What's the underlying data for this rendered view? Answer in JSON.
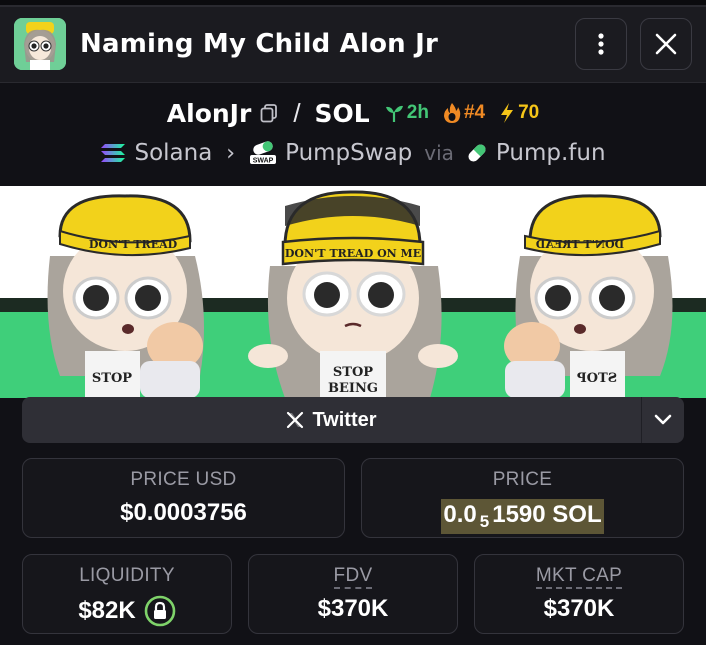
{
  "window": {
    "title": "Naming My Child Alon Jr"
  },
  "pair": {
    "base": "AlonJr",
    "separator": "/",
    "quote": "SOL",
    "age": "2h",
    "rank": "#4",
    "boost": "70"
  },
  "chain": {
    "network": "Solana",
    "dex": "PumpSwap",
    "via_label": "via",
    "launchpad": "Pump.fun"
  },
  "banner": {
    "hat_text_center": "DON'T TREAD ON ME",
    "hat_text_left": "DON'T TREAD",
    "hat_text_right": "DON'T TREAD",
    "shirt_text_center_1": "STOP",
    "shirt_text_center_2": "BEING",
    "shirt_text_left": "STOP",
    "shirt_text_right": "STOP"
  },
  "links": {
    "twitter_label": "Twitter"
  },
  "metrics": {
    "price_usd_label": "PRICE USD",
    "price_usd_value": "$0.0003756",
    "price_label": "PRICE",
    "price_prefix": "0.0",
    "price_zeros": "5",
    "price_digits": "1590",
    "price_unit": "SOL",
    "liquidity_label": "LIQUIDITY",
    "liquidity_value": "$82K",
    "fdv_label": "FDV",
    "fdv_value": "$370K",
    "mktcap_label": "MKT CAP",
    "mktcap_value": "$370K"
  },
  "colors": {
    "accent_green": "#43c676",
    "accent_orange": "#f08a24",
    "accent_yellow": "#f5c518",
    "banner_green": "#3fcf7a"
  }
}
